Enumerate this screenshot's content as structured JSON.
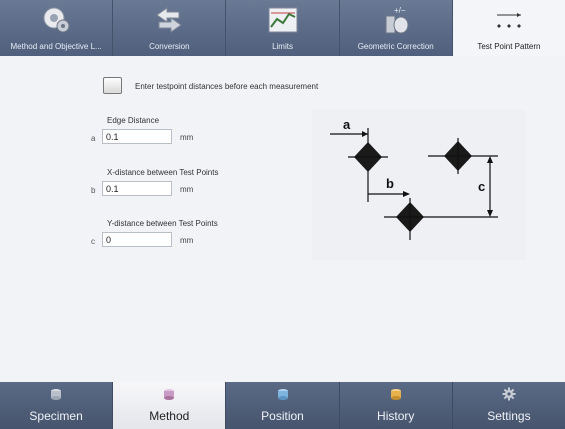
{
  "top_tabs": [
    {
      "label": "Method and Objective L...",
      "icon": "lens-disc-icon",
      "active": false
    },
    {
      "label": "Conversion",
      "icon": "convert-arrows-icon",
      "active": false
    },
    {
      "label": "Limits",
      "icon": "limits-graph-icon",
      "active": false
    },
    {
      "label": "Geometric Correction",
      "icon": "geometric-correction-icon",
      "active": false
    },
    {
      "label": "Test Point Pattern",
      "icon": "test-point-pattern-icon",
      "active": true
    }
  ],
  "checkbox": {
    "label": "Enter testpoint distances before each measurement",
    "checked": false
  },
  "fields": {
    "edge": {
      "title": "Edge Distance",
      "letter": "a",
      "value": "0.1",
      "unit": "mm"
    },
    "x": {
      "title": "X-distance between Test Points",
      "letter": "b",
      "value": "0.1",
      "unit": "mm"
    },
    "y": {
      "title": "Y-distance between Test Points",
      "letter": "c",
      "value": "0",
      "unit": "mm"
    }
  },
  "diagram": {
    "labels": {
      "a": "a",
      "b": "b",
      "c": "c"
    }
  },
  "bottom_tabs": [
    {
      "label": "Specimen",
      "icon": "specimen-icon",
      "color": "#b9c0cc",
      "active": false
    },
    {
      "label": "Method",
      "icon": "method-icon",
      "color": "#c79bc3",
      "active": true
    },
    {
      "label": "Position",
      "icon": "position-icon",
      "color": "#7fb4de",
      "active": false
    },
    {
      "label": "History",
      "icon": "history-icon",
      "color": "#e7b24e",
      "active": false
    },
    {
      "label": "Settings",
      "icon": "gear-icon",
      "color": "#c8ccd4",
      "active": false
    }
  ],
  "colors": {
    "top_bar": "#5a6a87",
    "bottom_bar": "#4f5d77",
    "active_tab": "#f4f5f8"
  }
}
